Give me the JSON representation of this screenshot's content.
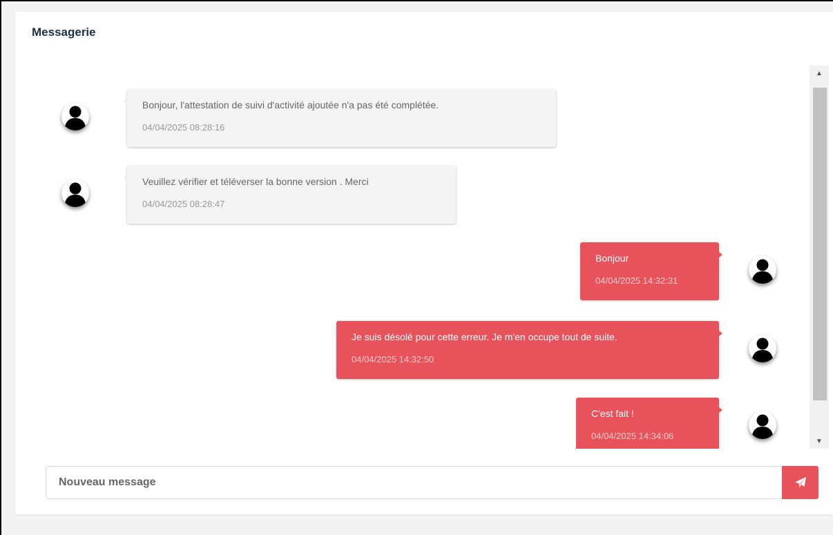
{
  "header": {
    "title": "Messagerie"
  },
  "messages": [
    {
      "direction": "in",
      "text": "Bonjour, l'attestation de suivi d'activité ajoutée n'a pas été complétée.",
      "time": "04/04/2025 08:28:16"
    },
    {
      "direction": "in",
      "text": "Veuillez vérifier et téléverser la bonne version . Merci",
      "time": "04/04/2025 08:28:47"
    },
    {
      "direction": "out",
      "text": "Bonjour",
      "time": "04/04/2025 14:32:31"
    },
    {
      "direction": "out",
      "text": "Je suis désolé pour cette erreur. Je m'en occupe tout de suite.",
      "time": "04/04/2025 14:32:50"
    },
    {
      "direction": "out",
      "text": "C'est fait !",
      "time": "04/04/2025 14:34:06"
    }
  ],
  "composer": {
    "placeholder": "Nouveau message",
    "value": ""
  },
  "icons": {
    "avatar": "user-silhouette-icon",
    "send": "paper-plane-icon",
    "scroll_up": "triangle-up-icon",
    "scroll_down": "triangle-down-icon"
  },
  "colors": {
    "accent": "#e8535b",
    "incoming_bubble": "#f4f4f4",
    "title": "#1e2d49"
  }
}
